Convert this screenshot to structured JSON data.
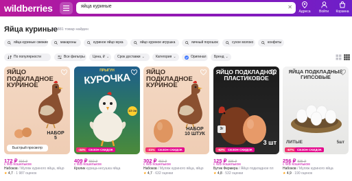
{
  "header": {
    "logo": "wildberries",
    "search_value": "яйца куриные",
    "buttons": [
      {
        "label": "Адреса",
        "icon": "location-icon"
      },
      {
        "label": "Войти",
        "icon": "user-icon"
      },
      {
        "label": "Корзина",
        "icon": "cart-icon"
      }
    ]
  },
  "page": {
    "title": "Яйца куриные",
    "count": "14 881 товар найден"
  },
  "chips": [
    "яйца куриные свежие",
    "макароны",
    "куриное яйцо мука",
    "яйцо куриное игрушка",
    "яичный порошок",
    "сухое молоко",
    "конфеты"
  ],
  "filters": {
    "sort": "По популярности",
    "all": "Все фильтры",
    "price": "Цена, ₽",
    "delivery": "Срок доставки",
    "category": "Категория",
    "original": "Оригинал",
    "brand": "Бренд"
  },
  "cards": [
    {
      "img_title": "ЯЙЦО ПОДКЛАДНОЕ КУРИНОЕ",
      "img_note": "НАБОР 5",
      "img_overlay": "Быстрый просмотр",
      "price": "172 ₽",
      "old_price": "316 ₽",
      "wallet": "с WB Кошельком",
      "brand": "Набоков",
      "name": " / Муляж куриного яйца, яйцо",
      "rating": "4,7",
      "reviews": "· 1 987 оценок",
      "discount": "",
      "sale": ""
    },
    {
      "img_title": "КУРОЧКА",
      "img_subtitle": "ПРЫГУН",
      "img_note": "13 см",
      "price": "409 ₽",
      "old_price": "550 ₽",
      "wallet": "с WB Кошельком",
      "brand": "Кролик",
      "name": " курица-несушка яйца",
      "rating": "",
      "reviews": "",
      "discount": "-34%",
      "sale": "СЕЗОН СКИДОК"
    },
    {
      "img_title": "ЯЙЦО ПОДКЛАДНОЕ КУРИНОЕ",
      "img_note": "НАБОР 10 ШТУК",
      "price": "302 ₽",
      "old_price": "450 ₽",
      "wallet": "с WB Кошельком",
      "brand": "Набоков",
      "name": " / Муляж куриного яйца, яйцо",
      "rating": "4,7",
      "reviews": "· 632 оценки",
      "discount": "-31%",
      "sale": "СЕЗОН СКИДОК"
    },
    {
      "img_title": "ЯЙЦО ПОДКЛАДНОЕ ПЛАСТИКОВОЕ",
      "img_note": "3 шт",
      "img_weight": "3г",
      "price": "125 ₽",
      "old_price": "336 ₽",
      "wallet": "с WB Кошельком",
      "brand": "Бутик Фермера",
      "name": " / Яйцо подкладное пл",
      "rating": "4,8",
      "reviews": "· 532 оценки",
      "discount": "-62%",
      "sale": "СЕЗОН СКИДОК"
    },
    {
      "img_title": "ЯЙЦА ПОДКЛАДНЫЕ ГИПСОВЫЕ",
      "img_note": "ЛИТЫЕ",
      "img_count": "5шт",
      "price": "256 ₽",
      "old_price": "835 ₽",
      "wallet": "с WB Кошельком",
      "brand": "Набоков",
      "name": " / Муляж куриного яйца",
      "rating": "4,9",
      "reviews": "· 190 оценок",
      "discount": "-67%",
      "sale": "СЕЗОН СКИДОК"
    }
  ],
  "colors": {
    "brand": "#cb11ab",
    "header_gradient_start": "#b91a9b",
    "header_gradient_end": "#6d1fc9",
    "discount": "#f0306e",
    "star": "#ff9c00"
  }
}
